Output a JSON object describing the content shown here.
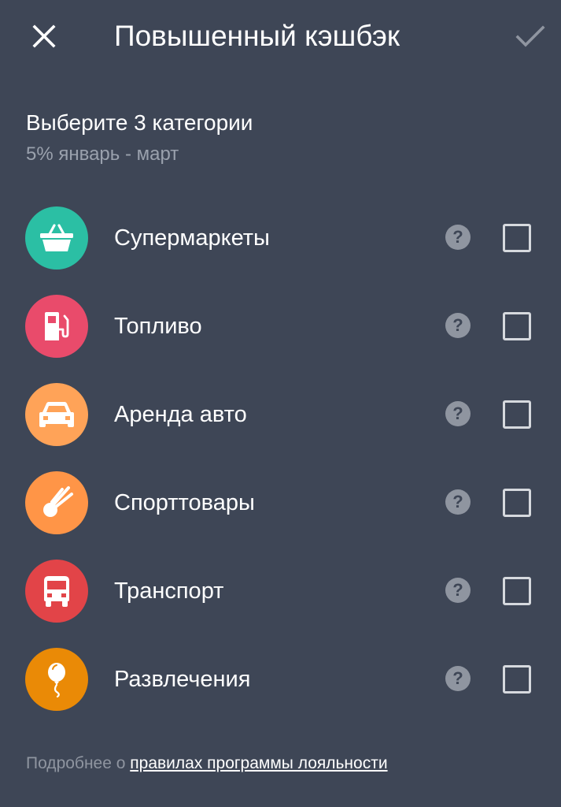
{
  "header": {
    "title": "Повышенный кэшбэк",
    "close_icon": "close-icon",
    "confirm_icon": "checkmark-icon"
  },
  "intro": {
    "heading": "Выберите 3 категории",
    "subheading": "5% январь - март"
  },
  "categories": [
    {
      "label": "Супермаркеты",
      "icon": "shopping-basket-icon",
      "color": "#2bbfa4",
      "checked": false
    },
    {
      "label": "Топливо",
      "icon": "fuel-pump-icon",
      "color": "#e94b6b",
      "checked": false
    },
    {
      "label": "Аренда авто",
      "icon": "car-icon",
      "color": "#ffa358",
      "checked": false
    },
    {
      "label": "Спорттовары",
      "icon": "shuttlecock-icon",
      "color": "#ff9547",
      "checked": false
    },
    {
      "label": "Транспорт",
      "icon": "bus-icon",
      "color": "#e24448",
      "checked": false
    },
    {
      "label": "Развлечения",
      "icon": "balloon-icon",
      "color": "#ea8a06",
      "checked": false
    }
  ],
  "help_symbol": "?",
  "footer": {
    "prefix": "Подробнее о ",
    "link": "правилах программы лояльности"
  }
}
